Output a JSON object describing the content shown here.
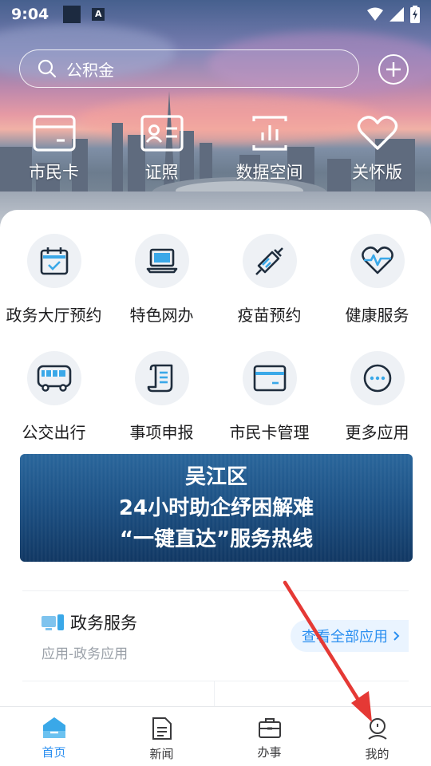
{
  "status_bar": {
    "time": "9:04",
    "a_badge": "A"
  },
  "search": {
    "placeholder": "公积金"
  },
  "quick_actions": [
    {
      "label": "市民卡",
      "icon": "card-icon"
    },
    {
      "label": "证照",
      "icon": "id-card-icon"
    },
    {
      "label": "数据空间",
      "icon": "chart-icon"
    },
    {
      "label": "关怀版",
      "icon": "heart-icon"
    }
  ],
  "services": [
    {
      "label": "政务大厅预约",
      "icon": "calendar-check-icon"
    },
    {
      "label": "特色网办",
      "icon": "laptop-icon"
    },
    {
      "label": "疫苗预约",
      "icon": "syringe-icon"
    },
    {
      "label": "健康服务",
      "icon": "heart-pulse-icon"
    },
    {
      "label": "公交出行",
      "icon": "bus-icon"
    },
    {
      "label": "事项申报",
      "icon": "scroll-icon"
    },
    {
      "label": "市民卡管理",
      "icon": "card-icon"
    },
    {
      "label": "更多应用",
      "icon": "more-icon"
    }
  ],
  "banner": {
    "line1": "吴江区",
    "line2": "24小时助企纾困解难",
    "line3": "“一键直达”服务热线"
  },
  "gov_card": {
    "title": "政务服务",
    "subtitle": "应用-政务应用",
    "view_all": "查看全部应用"
  },
  "bottom_nav": [
    {
      "label": "首页",
      "icon": "home-icon",
      "active": true
    },
    {
      "label": "新闻",
      "icon": "news-icon",
      "active": false
    },
    {
      "label": "办事",
      "icon": "briefcase-icon",
      "active": false
    },
    {
      "label": "我的",
      "icon": "user-icon",
      "active": false
    }
  ],
  "colors": {
    "accent": "#2b8ff0",
    "icon_stroke": "#1f2d3d",
    "icon_accent": "#3aa8e8",
    "arrow": "#e53935"
  }
}
